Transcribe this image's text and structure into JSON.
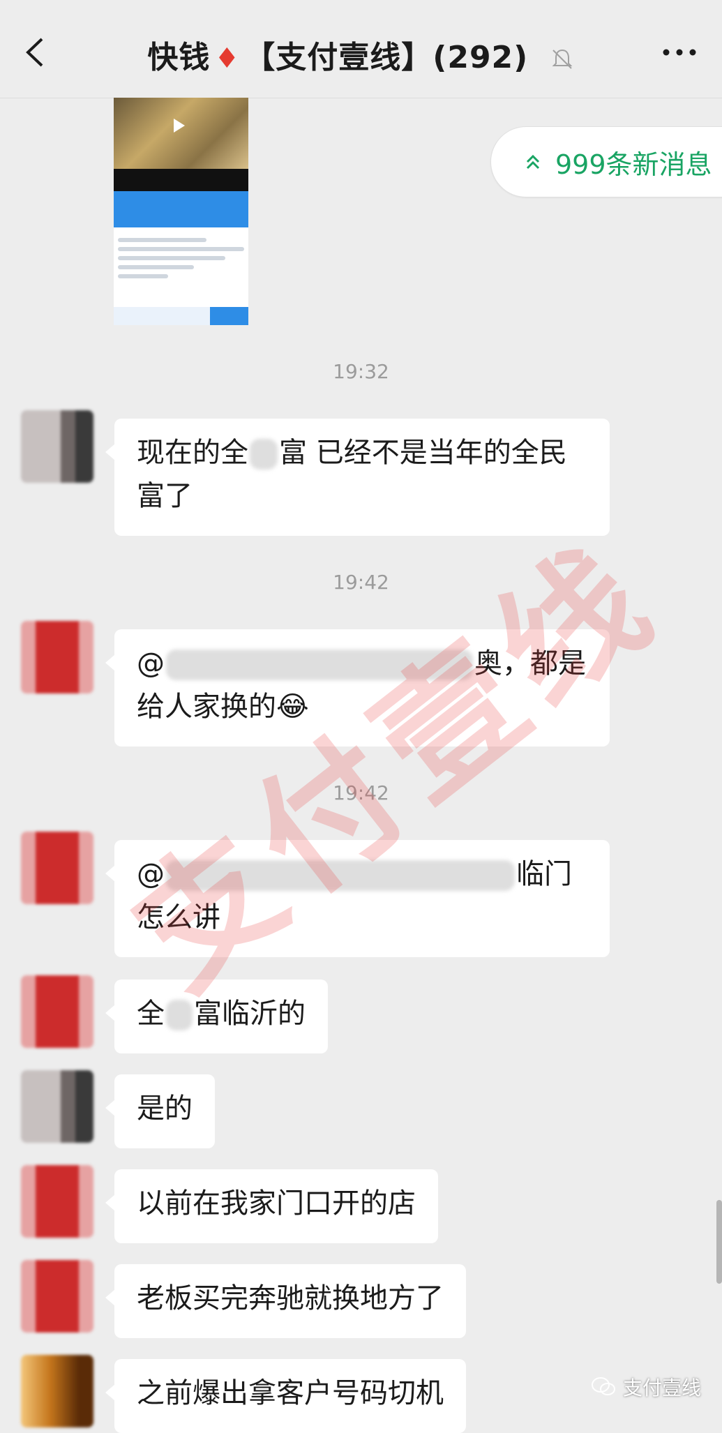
{
  "header": {
    "title_prefix": "快钱",
    "diamond": "♦",
    "title_main": "【支付壹线】(292)"
  },
  "new_messages": {
    "label": "999条新消息"
  },
  "messages": [
    {
      "time": "19:32",
      "text_a": "现在的全",
      "text_b": "富 已经不是当年的全民富了"
    },
    {
      "time": "19:42",
      "text_a": "@",
      "text_b": "奥，都是给人家换的😂"
    },
    {
      "time": "19:42",
      "text_a": "@",
      "text_b": "临门 怎么讲"
    },
    {
      "text_a": "全",
      "text_b": "富临沂的"
    },
    {
      "text": "是的"
    },
    {
      "text": "以前在我家门口开的店"
    },
    {
      "text": "老板买完奔驰就换地方了"
    },
    {
      "text": "之前爆出拿客户号码切机"
    }
  ],
  "watermark": "支付壹线",
  "source": "支付壹线",
  "colors": {
    "accent_green": "#19a463",
    "watermark_red": "#e83c3c",
    "background": "#ededed"
  }
}
